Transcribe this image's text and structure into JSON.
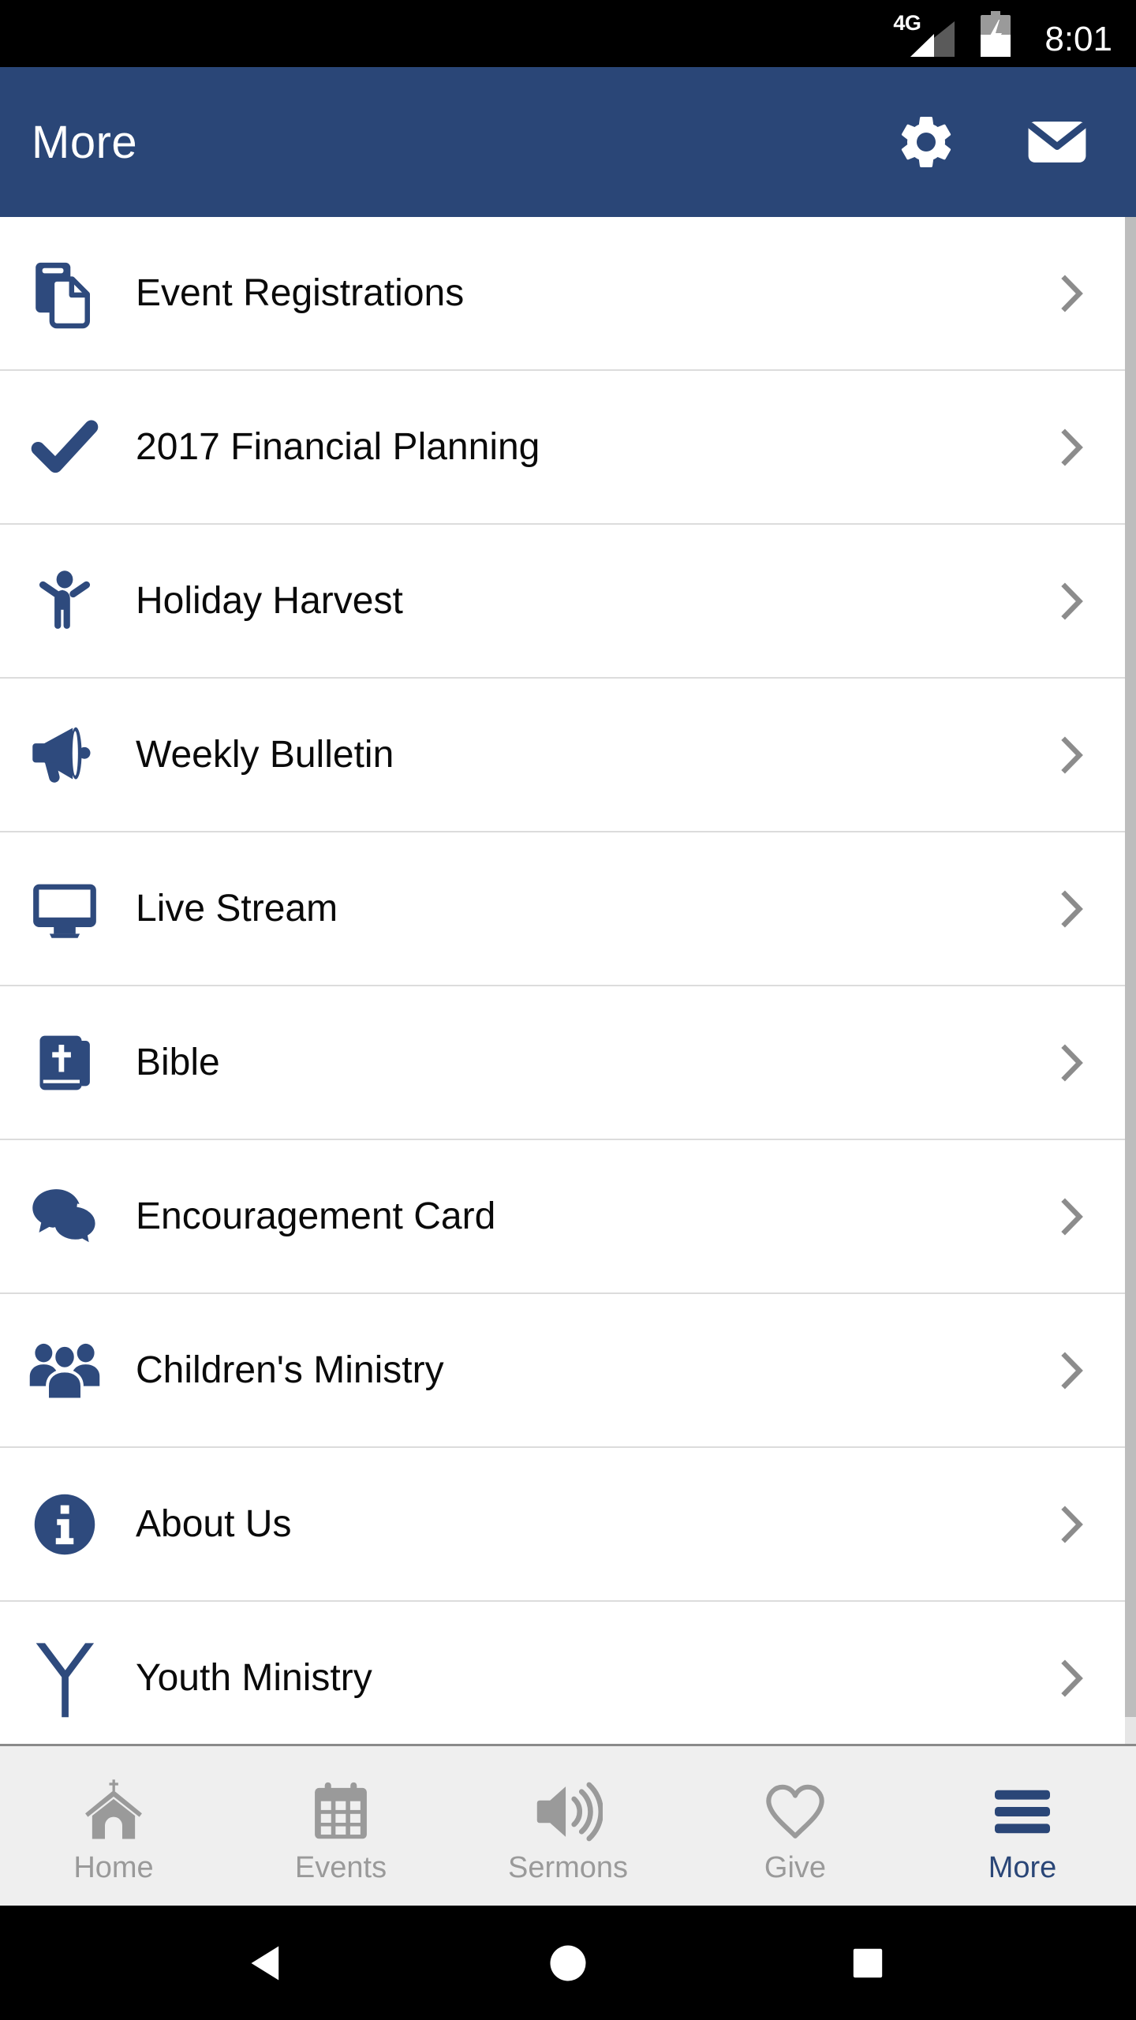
{
  "status_bar": {
    "network_label": "4G",
    "signal_icon": "signal-bars-icon",
    "battery_icon": "battery-charging-icon",
    "time": "8:01"
  },
  "header": {
    "title": "More",
    "background_color": "#2a4677",
    "actions": [
      {
        "name": "settings",
        "icon": "gear-icon"
      },
      {
        "name": "messages",
        "icon": "envelope-icon"
      }
    ]
  },
  "theme": {
    "brand_navy": "#2a4677",
    "icon_blue": "#2e4a7d",
    "chevron_gray": "#8c8c8c",
    "tab_inactive_gray": "#9a9a9a",
    "divider_gray": "#dcdcdc",
    "tabbar_bg": "#efefef"
  },
  "menu": {
    "items": [
      {
        "label": "Event Registrations",
        "icon": "documents-copy-icon"
      },
      {
        "label": "2017 Financial Planning",
        "icon": "checkmark-icon"
      },
      {
        "label": "Holiday Harvest",
        "icon": "person-raised-arms-icon"
      },
      {
        "label": "Weekly Bulletin",
        "icon": "megaphone-icon"
      },
      {
        "label": "Live Stream",
        "icon": "monitor-icon"
      },
      {
        "label": "Bible",
        "icon": "bible-book-icon"
      },
      {
        "label": "Encouragement Card",
        "icon": "speech-bubbles-icon"
      },
      {
        "label": "Children's Ministry",
        "icon": "people-group-icon"
      },
      {
        "label": "About Us",
        "icon": "info-circle-icon"
      },
      {
        "label": "Youth Ministry",
        "icon": "letter-y-icon"
      }
    ],
    "chevron_icon": "chevron-right-icon"
  },
  "tab_bar": {
    "active": "More",
    "tabs": [
      {
        "label": "Home",
        "icon": "church-icon",
        "active": false
      },
      {
        "label": "Events",
        "icon": "calendar-icon",
        "active": false
      },
      {
        "label": "Sermons",
        "icon": "speaker-volume-icon",
        "active": false
      },
      {
        "label": "Give",
        "icon": "heart-outline-icon",
        "active": false
      },
      {
        "label": "More",
        "icon": "hamburger-menu-icon",
        "active": true
      }
    ]
  },
  "android_nav": {
    "buttons": [
      {
        "name": "back",
        "icon": "triangle-back-icon"
      },
      {
        "name": "home",
        "icon": "circle-home-icon"
      },
      {
        "name": "recents",
        "icon": "square-recents-icon"
      }
    ]
  }
}
